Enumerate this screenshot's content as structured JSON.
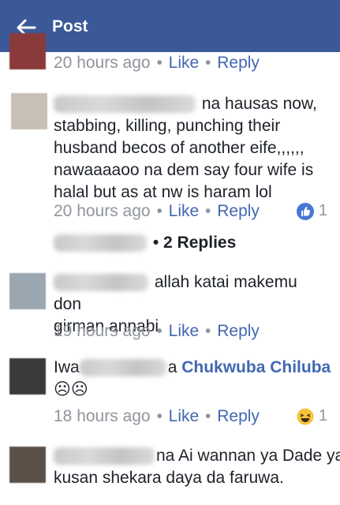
{
  "header": {
    "title": "Post"
  },
  "comments": [
    {
      "time": "20 hours ago",
      "like": "Like",
      "reply": "Reply"
    },
    {
      "text_lines": [
        "na hausas now,",
        "stabbing, killing, punching their",
        "husband becos of another eife,,,,,,",
        "nawaaaaoo na dem say four wife is",
        "halal but as at nw is haram lol"
      ],
      "time": "20 hours ago",
      "like": "Like",
      "reply": "Reply",
      "reaction_count": "1"
    }
  ],
  "replies_summary": "2 Replies",
  "replies": [
    {
      "text_lines": [
        "allah katai makemu don",
        "girman annabi"
      ],
      "time": "19 hours ago",
      "like": "Like",
      "reply": "Reply"
    },
    {
      "prefix": "Iwa",
      "suffix": "a",
      "mention": "Chukwuba Chiluba",
      "emoji": "☹☹",
      "time": "18 hours ago",
      "like": "Like",
      "reply": "Reply",
      "reaction_count": "1"
    },
    {
      "suffix": "na",
      "text_lines": [
        "Ai wannan ya Dade ya",
        "kusan shekara daya da faruwa."
      ]
    }
  ],
  "dot": "•"
}
